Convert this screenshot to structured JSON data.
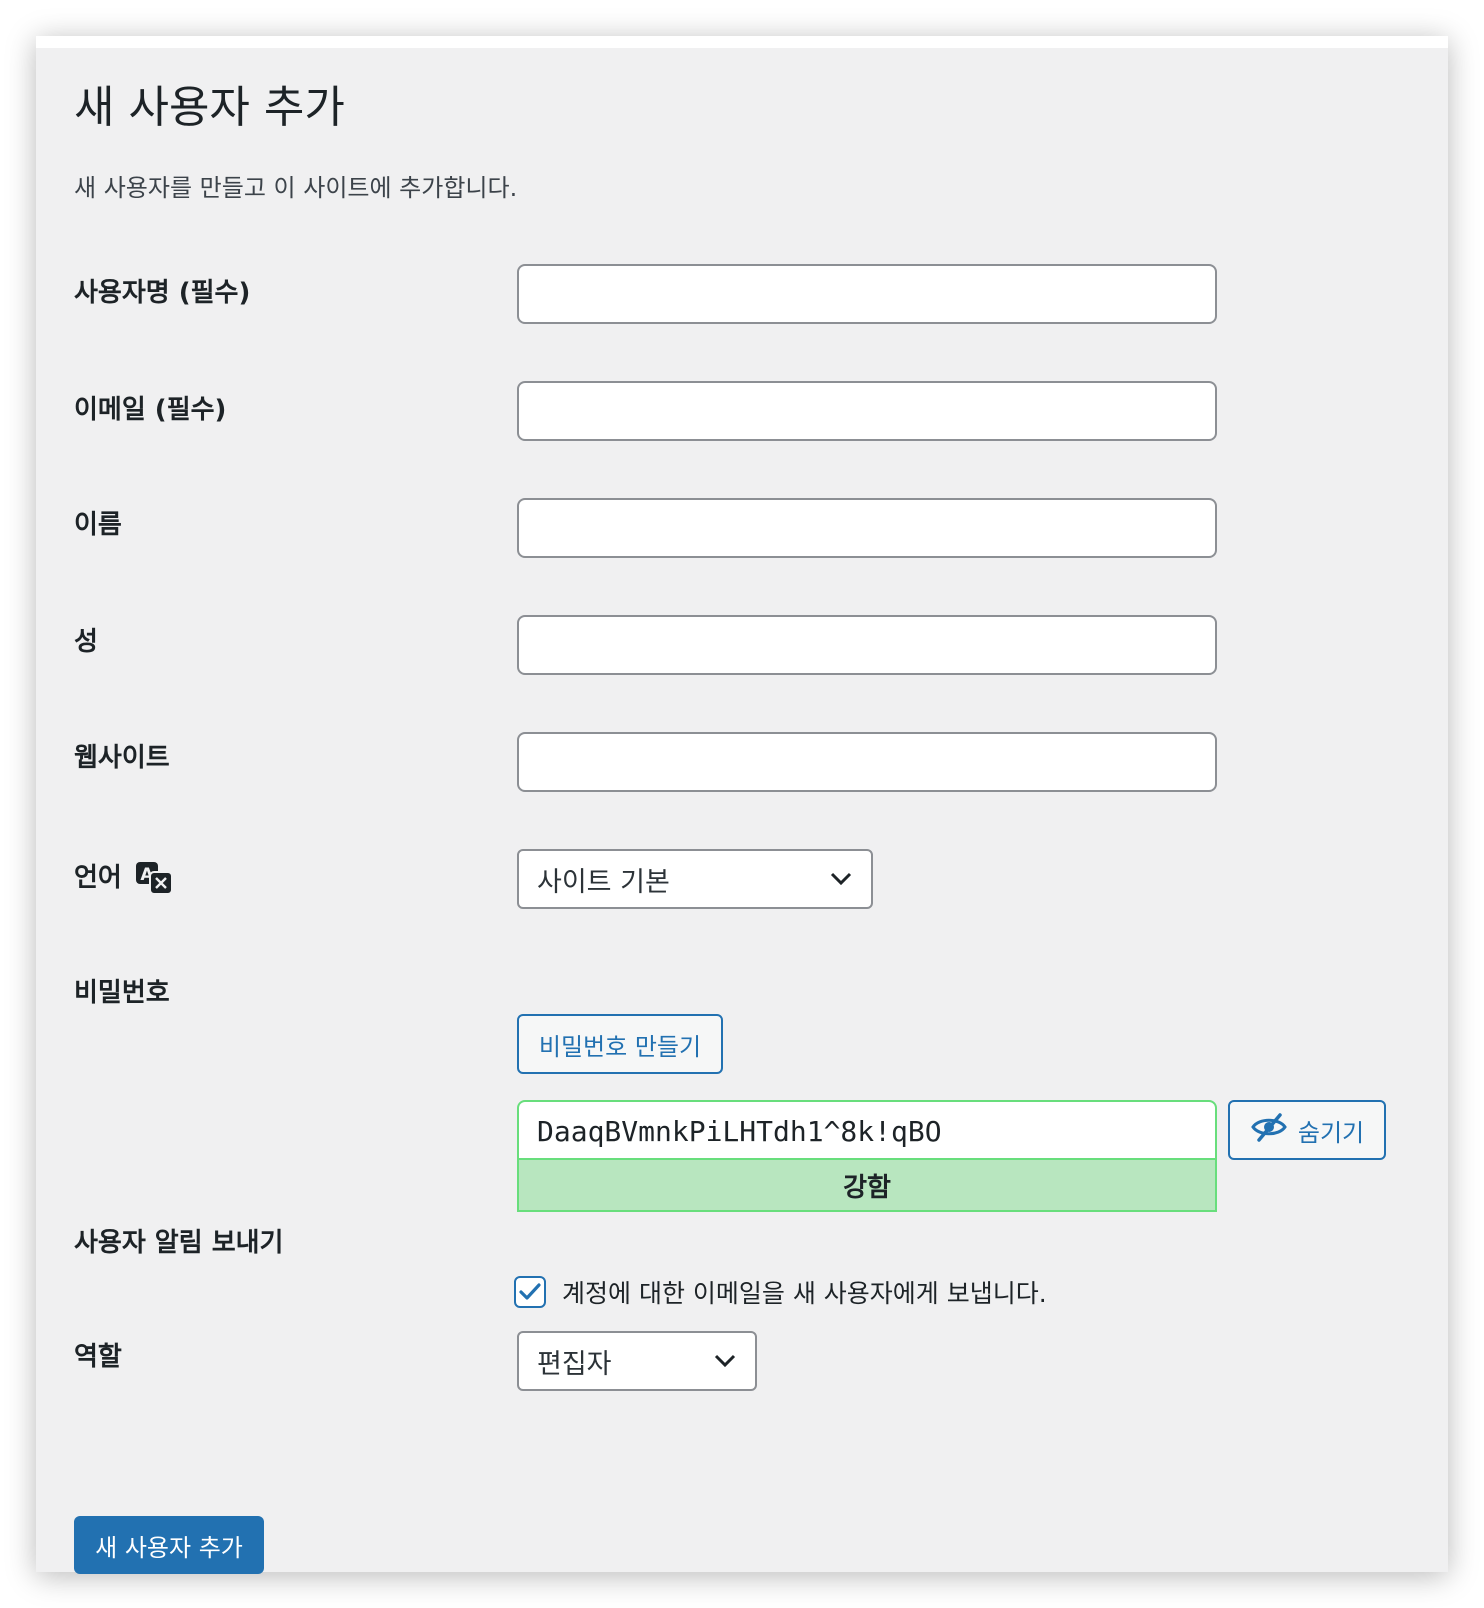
{
  "page": {
    "title": "새 사용자 추가",
    "description": "새 사용자를 만들고 이 사이트에 추가합니다."
  },
  "fields": {
    "username": {
      "label": "사용자명 (필수)",
      "value": ""
    },
    "email": {
      "label": "이메일 (필수)",
      "value": ""
    },
    "first_name": {
      "label": "이름",
      "value": ""
    },
    "last_name": {
      "label": "성",
      "value": ""
    },
    "website": {
      "label": "웹사이트",
      "value": ""
    },
    "language": {
      "label": "언어",
      "icon": "translate-icon",
      "selected": "사이트 기본"
    },
    "password": {
      "label": "비밀번호",
      "generate_label": "비밀번호 만들기",
      "value": "DaaqBVmnkPiLHTdh1^8k!qBO",
      "strength": "강함",
      "hide_label": "숨기기",
      "hide_icon": "eye-slash-icon"
    },
    "notify": {
      "label": "사용자 알림 보내기",
      "checkbox_label": "계정에 대한 이메일을 새 사용자에게 보냅니다.",
      "checked": true
    },
    "role": {
      "label": "역할",
      "selected": "편집자"
    }
  },
  "submit": {
    "label": "새 사용자 추가"
  },
  "colors": {
    "accent": "#2271b1",
    "strong_meter_bg": "#b8e6bf",
    "strong_meter_border": "#68de7c",
    "panel_bg": "#f0f0f1"
  }
}
